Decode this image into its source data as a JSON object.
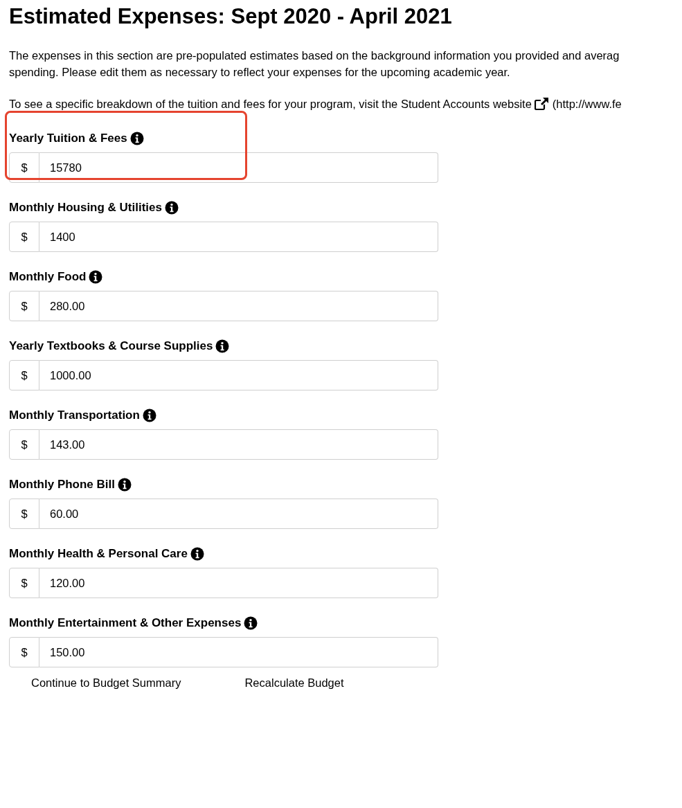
{
  "title": "Estimated Expenses: Sept 2020 - April 2021",
  "intro_lines": [
    "The expenses in this section are pre-populated estimates based on the background information you provided and averag",
    "spending. Please edit them as necessary to reflect your expenses for the upcoming academic year."
  ],
  "tuition_note": {
    "text": "To see a specific breakdown of the tuition and fees for your program, visit the Student Accounts website",
    "link": "(http://www.fe"
  },
  "fields": [
    {
      "label": "Yearly Tuition & Fees",
      "prefix": "$",
      "value": "15780",
      "highlighted": true
    },
    {
      "label": "Monthly Housing & Utilities",
      "prefix": "$",
      "value": "1400",
      "highlighted": false
    },
    {
      "label": "Monthly Food",
      "prefix": "$",
      "value": "280.00",
      "highlighted": false
    },
    {
      "label": "Yearly Textbooks & Course Supplies",
      "prefix": "$",
      "value": "1000.00",
      "highlighted": false
    },
    {
      "label": "Monthly Transportation",
      "prefix": "$",
      "value": "143.00",
      "highlighted": false
    },
    {
      "label": "Monthly Phone Bill",
      "prefix": "$",
      "value": "60.00",
      "highlighted": false
    },
    {
      "label": "Monthly Health & Personal Care",
      "prefix": "$",
      "value": "120.00",
      "highlighted": false
    },
    {
      "label": "Monthly Entertainment & Other Expenses",
      "prefix": "$",
      "value": "150.00",
      "highlighted": false
    }
  ],
  "buttons": [
    "Continue to Budget Summary",
    "Recalculate Budget"
  ]
}
